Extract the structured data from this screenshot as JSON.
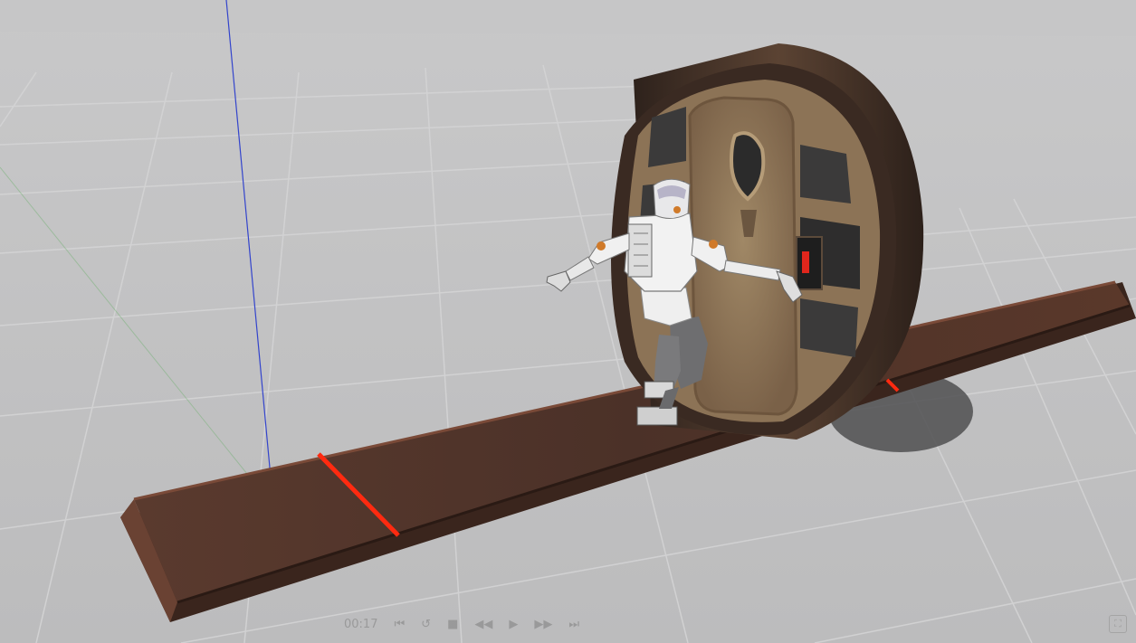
{
  "scene": {
    "colors": {
      "ground": "#bdbdbe",
      "grid_line": "#d2d2d3",
      "axis_z": "#3344cc",
      "walkway": "#4a3128",
      "walkway_edge": "#6b4030",
      "wheel_rim": "#3a2a22",
      "door_panel": "#8c7356",
      "marker": "#ff2a10",
      "robot_body": "#f0f0f0",
      "robot_joint": "#d07a2a",
      "robot_legs": "#6e6e70"
    },
    "icons": {
      "step_back": "step-back-icon",
      "reset": "reset-icon",
      "stop": "stop-icon",
      "rewind": "rewind-icon",
      "play": "play-icon",
      "fast_forward": "fast-forward-icon",
      "step_forward": "step-forward-icon",
      "fullscreen": "fullscreen-icon"
    }
  },
  "playback": {
    "time_label": "00:17"
  }
}
